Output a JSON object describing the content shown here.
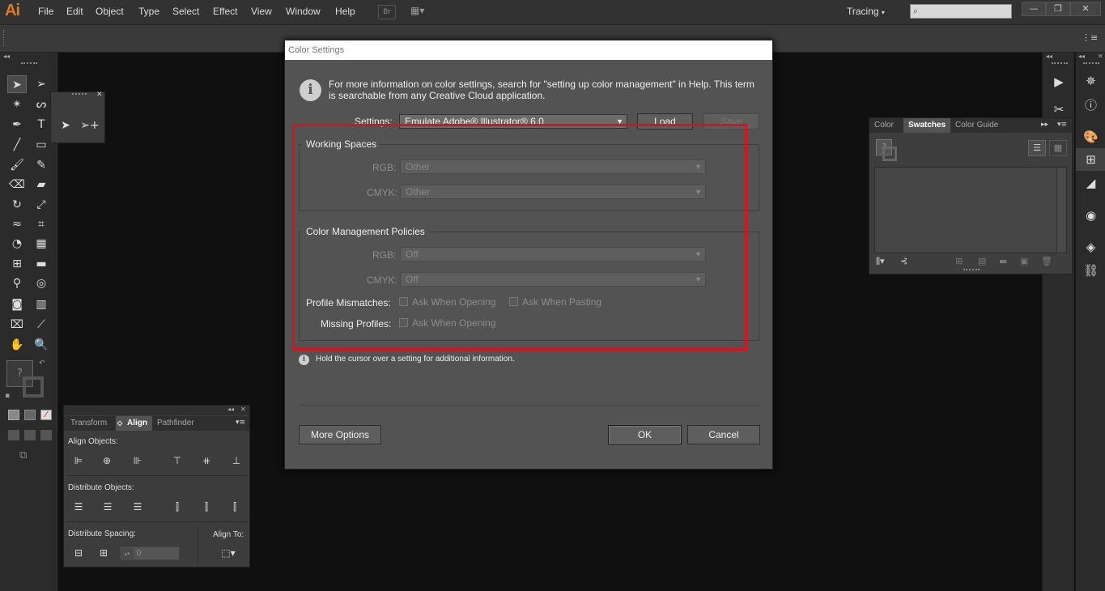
{
  "app": {
    "logo": "Ai"
  },
  "menu": [
    "File",
    "Edit",
    "Object",
    "Type",
    "Select",
    "Effect",
    "View",
    "Window",
    "Help"
  ],
  "menu_buttons": {
    "bridge": "Br",
    "arrange": "▦▾"
  },
  "workspace": {
    "label": "Tracing"
  },
  "window_controls": {
    "minimize": "—",
    "restore": "❐",
    "close": "✕"
  },
  "swatches_panel": {
    "tabs": [
      "Color",
      "Swatches",
      "Color Guide"
    ],
    "active_tab": "Swatches"
  },
  "align_panel": {
    "tabs": [
      "Transform",
      "Align",
      "Pathfinder"
    ],
    "active_tab": "Align",
    "align_objects": "Align Objects:",
    "distribute_objects": "Distribute Objects:",
    "distribute_spacing": "Distribute Spacing:",
    "align_to": "Align To:",
    "spacing_value": "0"
  },
  "dialog": {
    "title": "Color Settings",
    "info": "For more information on color settings, search for \"setting up color management\" in Help. This term is searchable from any Creative Cloud application.",
    "settings_label": "Settings:",
    "settings_value": "Emulate Adobe® Illustrator® 6.0",
    "load": "Load",
    "save": "Save",
    "working_spaces": "Working Spaces",
    "rgb_label": "RGB:",
    "rgb_value": "Other",
    "cmyk_label": "CMYK:",
    "cmyk_value": "Other",
    "policies": "Color Management Policies",
    "policy_rgb_value": "Off",
    "policy_cmyk_value": "Off",
    "profile_mismatches": "Profile Mismatches:",
    "ask_opening": "Ask When Opening",
    "ask_pasting": "Ask When Pasting",
    "missing_profiles": "Missing Profiles:",
    "hint": "Hold the cursor over a setting for additional information.",
    "more_options": "More Options",
    "ok": "OK",
    "cancel": "Cancel"
  },
  "colors": {
    "highlight": "#d7141b",
    "logo": "#e07a1f"
  }
}
